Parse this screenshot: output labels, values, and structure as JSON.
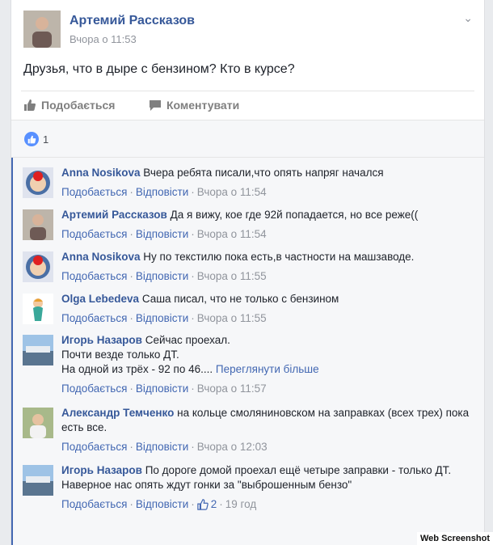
{
  "post": {
    "author": "Артемий Рассказов",
    "time": "Вчора о 11:53",
    "text": "Друзья, что в дыре с бензином? Кто в курсе?",
    "like_label": "Подобається",
    "comment_label": "Коментувати",
    "reaction_count": "1"
  },
  "comments": [
    {
      "author": "Anna Nosikova",
      "text": "Вчера ребята писали,что опять напряг начался",
      "like": "Подобається",
      "reply": "Відповісти",
      "time": "Вчора о 11:54"
    },
    {
      "author": "Артемий Рассказов",
      "text": "Да я вижу, кое где 92й попадается, но все реже((",
      "like": "Подобається",
      "reply": "Відповісти",
      "time": "Вчора о 11:54"
    },
    {
      "author": "Anna Nosikova",
      "text": "Ну по текстилю пока есть,в частности на машзаводе.",
      "like": "Подобається",
      "reply": "Відповісти",
      "time": "Вчора о 11:55"
    },
    {
      "author": "Olga Lebedeva",
      "text": "Саша писал, что не только с бензином",
      "like": "Подобається",
      "reply": "Відповісти",
      "time": "Вчора о 11:55"
    },
    {
      "author": "Игорь Назаров",
      "text": "Сейчас проехал.",
      "text2": "Почти везде только ДТ.",
      "text3": "На одной из трёх - 92 по 46....",
      "more": "Переглянути більше",
      "like": "Подобається",
      "reply": "Відповісти",
      "time": "Вчора о 11:57"
    },
    {
      "author": "Александр Темченко",
      "text": "на кольце смоляниновском на заправках (всех трех) пока есть все.",
      "like": "Подобається",
      "reply": "Відповісти",
      "time": "Вчора о 12:03"
    },
    {
      "author": "Игорь Назаров",
      "text": "По дороге домой проехал ещё четыре заправки - только ДТ.",
      "text2": "Наверное нас опять ждут гонки за \"выброшенным бензо\"",
      "like": "Подобається",
      "reply": "Відповісти",
      "likes": "2",
      "time": "19 год"
    }
  ],
  "watermark": "Web Screenshot",
  "colors": {
    "link": "#365899",
    "accent": "#4267b2",
    "meta": "#90949c",
    "bg": "#e9ebee"
  }
}
